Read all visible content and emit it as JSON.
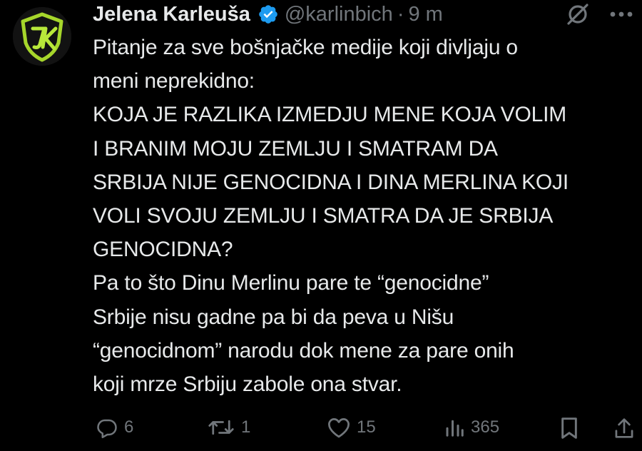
{
  "author": {
    "name": "Jelena Karleuša",
    "handle": "@karlinbich",
    "separator": "·",
    "time": "9 m"
  },
  "avatar": {
    "icon": "jk-shield-logo-icon",
    "initials": "JK",
    "colors": {
      "shield": "#a6d62b",
      "bg": "#111111"
    }
  },
  "header_actions": {
    "grok_icon": "grok-slash-icon",
    "more_icon": "more-options-icon"
  },
  "tweet": {
    "lines": [
      "Pitanje za sve bošnjačke medije koji divljaju o",
      "meni neprekidno:",
      "KOJA JE RAZLIKA IZMEDJU MENE KOJA VOLIM",
      "I BRANIM MOJU ZEMLJU I SMATRAM DA",
      "SRBIJA NIJE GENOCIDNA I DINA MERLINA KOJI",
      "VOLI SVOJU ZEMLJU I SMATRA DA JE SRBIJA",
      "GENOCIDNA?",
      "Pa to što Dinu Merlinu pare te “genocidne”",
      "Srbije nisu gadne pa bi da peva u Nišu",
      "“genocidnom” narodu dok mene za pare onih",
      "koji mrze Srbiju zabole ona stvar."
    ]
  },
  "actions": {
    "replies": "6",
    "reposts": "1",
    "likes": "15",
    "views": "365",
    "icons": [
      "reply-icon",
      "repost-icon",
      "like-icon",
      "views-icon",
      "bookmark-icon",
      "share-icon"
    ]
  },
  "colors": {
    "background": "#000000",
    "text": "#e7e9ea",
    "secondary": "#71767b",
    "verified": "#1d9bf0"
  }
}
